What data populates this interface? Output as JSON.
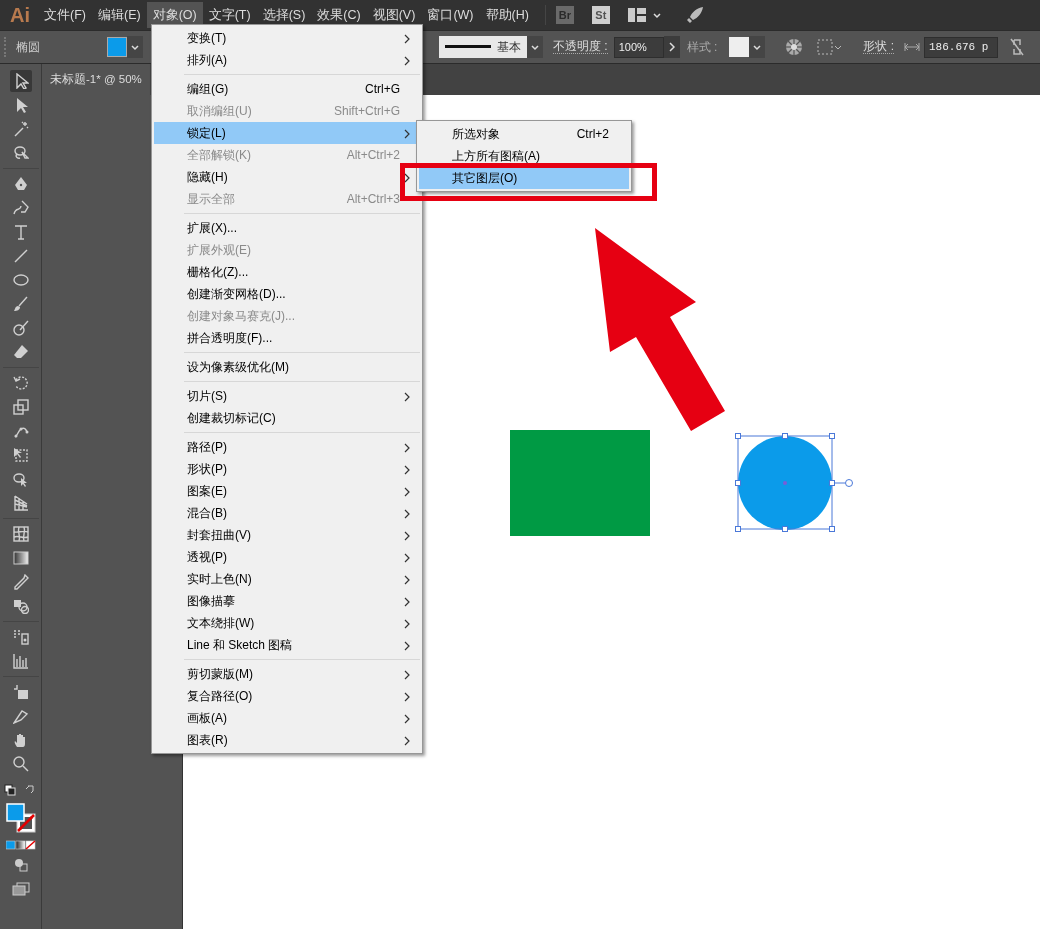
{
  "app_logo": "Ai",
  "menubar": [
    {
      "label": "文件(F)",
      "selected": false
    },
    {
      "label": "编辑(E)",
      "selected": false
    },
    {
      "label": "对象(O)",
      "selected": true
    },
    {
      "label": "文字(T)",
      "selected": false
    },
    {
      "label": "选择(S)",
      "selected": false
    },
    {
      "label": "效果(C)",
      "selected": false
    },
    {
      "label": "视图(V)",
      "selected": false
    },
    {
      "label": "窗口(W)",
      "selected": false
    },
    {
      "label": "帮助(H)",
      "selected": false
    }
  ],
  "app_buttons": [
    {
      "label": "Br",
      "disabled": true
    },
    {
      "label": "St",
      "disabled": false
    }
  ],
  "control_bar": {
    "tool_name": "椭圆",
    "stroke_profile": "基本",
    "opacity_label": "不透明度 :",
    "opacity_value": "100%",
    "style_label": "样式 :",
    "shape_label": "形状 :",
    "width_value": "186.676 p"
  },
  "document_tab": {
    "title": "未标题-1* @ 50%"
  },
  "object_menu": {
    "groups": [
      [
        {
          "label": "变换(T)",
          "submenu": true,
          "disabled": false,
          "selected": false
        },
        {
          "label": "排列(A)",
          "submenu": true,
          "disabled": false,
          "selected": false
        }
      ],
      [
        {
          "label": "编组(G)",
          "shortcut": "Ctrl+G",
          "submenu": false,
          "disabled": false,
          "selected": false
        },
        {
          "label": "取消编组(U)",
          "shortcut": "Shift+Ctrl+G",
          "submenu": false,
          "disabled": true,
          "selected": false
        },
        {
          "label": "锁定(L)",
          "submenu": true,
          "disabled": false,
          "selected": true
        },
        {
          "label": "全部解锁(K)",
          "shortcut": "Alt+Ctrl+2",
          "submenu": false,
          "disabled": true,
          "selected": false
        },
        {
          "label": "隐藏(H)",
          "submenu": true,
          "disabled": false,
          "selected": false
        },
        {
          "label": "显示全部",
          "shortcut": "Alt+Ctrl+3",
          "submenu": false,
          "disabled": true,
          "selected": false
        }
      ],
      [
        {
          "label": "扩展(X)...",
          "submenu": false,
          "disabled": false,
          "selected": false
        },
        {
          "label": "扩展外观(E)",
          "submenu": false,
          "disabled": true,
          "selected": false
        },
        {
          "label": "栅格化(Z)...",
          "submenu": false,
          "disabled": false,
          "selected": false
        },
        {
          "label": "创建渐变网格(D)...",
          "submenu": false,
          "disabled": false,
          "selected": false
        },
        {
          "label": "创建对象马赛克(J)...",
          "submenu": false,
          "disabled": true,
          "selected": false
        },
        {
          "label": "拼合透明度(F)...",
          "submenu": false,
          "disabled": false,
          "selected": false
        }
      ],
      [
        {
          "label": "设为像素级优化(M)",
          "submenu": false,
          "disabled": false,
          "selected": false
        }
      ],
      [
        {
          "label": "切片(S)",
          "submenu": true,
          "disabled": false,
          "selected": false
        },
        {
          "label": "创建裁切标记(C)",
          "submenu": false,
          "disabled": false,
          "selected": false
        }
      ],
      [
        {
          "label": "路径(P)",
          "submenu": true,
          "disabled": false,
          "selected": false
        },
        {
          "label": "形状(P)",
          "submenu": true,
          "disabled": false,
          "selected": false
        },
        {
          "label": "图案(E)",
          "submenu": true,
          "disabled": false,
          "selected": false
        },
        {
          "label": "混合(B)",
          "submenu": true,
          "disabled": false,
          "selected": false
        },
        {
          "label": "封套扭曲(V)",
          "submenu": true,
          "disabled": false,
          "selected": false
        },
        {
          "label": "透视(P)",
          "submenu": true,
          "disabled": false,
          "selected": false
        },
        {
          "label": "实时上色(N)",
          "submenu": true,
          "disabled": false,
          "selected": false
        },
        {
          "label": "图像描摹",
          "submenu": true,
          "disabled": false,
          "selected": false
        },
        {
          "label": "文本绕排(W)",
          "submenu": true,
          "disabled": false,
          "selected": false
        },
        {
          "label": "Line 和 Sketch 图稿",
          "submenu": true,
          "disabled": false,
          "selected": false
        }
      ],
      [
        {
          "label": "剪切蒙版(M)",
          "submenu": true,
          "disabled": false,
          "selected": false
        },
        {
          "label": "复合路径(O)",
          "submenu": true,
          "disabled": false,
          "selected": false
        },
        {
          "label": "画板(A)",
          "submenu": true,
          "disabled": false,
          "selected": false
        },
        {
          "label": "图表(R)",
          "submenu": true,
          "disabled": false,
          "selected": false
        }
      ]
    ]
  },
  "lock_submenu": [
    {
      "label": "所选对象",
      "shortcut": "Ctrl+2",
      "selected": false
    },
    {
      "label": "上方所有图稿(A)",
      "selected": false
    },
    {
      "label": "其它图层(O)",
      "selected": true
    }
  ]
}
